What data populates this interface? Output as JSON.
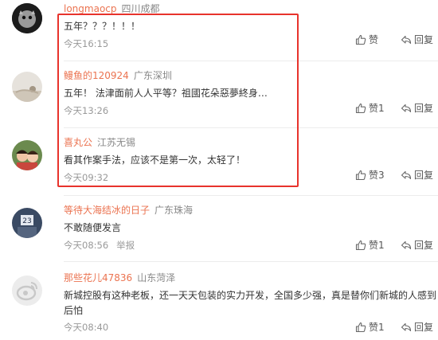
{
  "comments": [
    {
      "username": "longmaocp",
      "location": "四川成都",
      "text": "五年？？？！！！",
      "time": "今天16:15",
      "like_label": "赞",
      "reply_label": "回复"
    },
    {
      "username": "鳗鱼的120924",
      "location": "广东深圳",
      "text": "五年！ 法津面前人人平等？祖國花朵惡夢終身…",
      "time": "今天13:26",
      "like_label": "赞1",
      "reply_label": "回复"
    },
    {
      "username": "喜丸公",
      "location": "江苏无锡",
      "text": "看其作案手法，应该不是第一次，太轻了！",
      "time": "今天09:32",
      "like_label": "赞3",
      "reply_label": "回复"
    },
    {
      "username": "等待大海结冰的日子",
      "location": "广东珠海",
      "text": "不敢随便发言",
      "time": "今天08:56",
      "report_label": "举报",
      "like_label": "赞1",
      "reply_label": "回复"
    },
    {
      "username": "那些花儿47836",
      "location": "山东菏泽",
      "text": "新城控股有这种老板，还一天天包装的实力开发，全国多少强，真是替你们新城的人感到后怕",
      "time": "今天08:40",
      "like_label": "赞1",
      "reply_label": "回复"
    }
  ],
  "colors": {
    "username": "#eb7350",
    "highlight_border": "#e8332c"
  }
}
